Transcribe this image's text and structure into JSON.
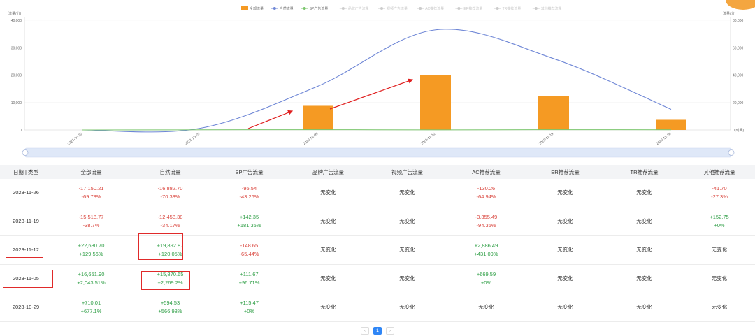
{
  "legend": [
    {
      "label": "全部流量",
      "color": "#f59a23",
      "active": true,
      "kind": "bar"
    },
    {
      "label": "自然流量",
      "color": "#6f87d6",
      "active": true,
      "kind": "line"
    },
    {
      "label": "SP广告流量",
      "color": "#7cc66e",
      "active": true,
      "kind": "line"
    },
    {
      "label": "品牌广告流量",
      "color": "#cccccc",
      "active": false,
      "kind": "line"
    },
    {
      "label": "视频广告流量",
      "color": "#cccccc",
      "active": false,
      "kind": "line"
    },
    {
      "label": "AC推荐流量",
      "color": "#cccccc",
      "active": false,
      "kind": "line"
    },
    {
      "label": "ER推荐流量",
      "color": "#cccccc",
      "active": false,
      "kind": "line"
    },
    {
      "label": "TR推荐流量",
      "color": "#cccccc",
      "active": false,
      "kind": "line"
    },
    {
      "label": "其他推荐流量",
      "color": "#cccccc",
      "active": false,
      "kind": "line"
    }
  ],
  "chart_data": {
    "type": "bar",
    "x": [
      "2023-10-22",
      "2023-10-29",
      "2023-11-05",
      "2023-11-12",
      "2023-11-19",
      "2023-11-26"
    ],
    "left_axis": {
      "label": "流量(分)",
      "ticks": [
        "0",
        "10,000",
        "20,000",
        "30,000",
        "40,000"
      ],
      "ylim": [
        0,
        40000
      ]
    },
    "right_axis": {
      "label": "流量(分)",
      "ticks": [
        "0(时间)",
        "20,000",
        "40,000",
        "60,000",
        "80,000"
      ],
      "ylim": [
        0,
        80000
      ]
    },
    "series": [
      {
        "name": "全部流量",
        "type": "bar",
        "axis": "left",
        "values": [
          0,
          110,
          8800,
          20000,
          12300,
          3700
        ]
      },
      {
        "name": "自然流量",
        "type": "line",
        "axis": "right",
        "values": [
          0,
          1200,
          32000,
          73000,
          52000,
          15000
        ]
      },
      {
        "name": "SP广告流量",
        "type": "line",
        "axis": "right",
        "values": [
          0,
          110,
          220,
          80,
          220,
          130
        ]
      }
    ],
    "annotations": [
      "red-arrow-1",
      "red-arrow-2"
    ]
  },
  "table": {
    "headers": [
      "日期 | 类型",
      "全部流量",
      "自然流量",
      "SP广告流量",
      "品牌广告流量",
      "视频广告流量",
      "AC推荐流量",
      "ER推荐流量",
      "TR推荐流量",
      "其他推荐流量"
    ],
    "rows": [
      {
        "date": "2023-11-26",
        "cells": [
          {
            "v": "-17,150.21",
            "p": "-69.78%",
            "c": "red"
          },
          {
            "v": "-16,882.70",
            "p": "-70.33%",
            "c": "red"
          },
          {
            "v": "-95.54",
            "p": "-43.26%",
            "c": "red"
          },
          {
            "v": "无变化",
            "c": "flat"
          },
          {
            "v": "无变化",
            "c": "flat"
          },
          {
            "v": "-130.26",
            "p": "-64.94%",
            "c": "red"
          },
          {
            "v": "无变化",
            "c": "flat"
          },
          {
            "v": "无变化",
            "c": "flat"
          },
          {
            "v": "-41.70",
            "p": "-27.3%",
            "c": "red"
          }
        ]
      },
      {
        "date": "2023-11-19",
        "cells": [
          {
            "v": "-15,518.77",
            "p": "-38.7%",
            "c": "red"
          },
          {
            "v": "-12,458.38",
            "p": "-34.17%",
            "c": "red"
          },
          {
            "v": "+142.35",
            "p": "+181.35%",
            "c": "green"
          },
          {
            "v": "无变化",
            "c": "flat"
          },
          {
            "v": "无变化",
            "c": "flat"
          },
          {
            "v": "-3,355.49",
            "p": "-94.36%",
            "c": "red"
          },
          {
            "v": "无变化",
            "c": "flat"
          },
          {
            "v": "无变化",
            "c": "flat"
          },
          {
            "v": "+152.75",
            "p": "+0%",
            "c": "green"
          }
        ]
      },
      {
        "date": "2023-11-12",
        "cells": [
          {
            "v": "+22,630.70",
            "p": "+129.56%",
            "c": "green"
          },
          {
            "v": "+19,892.87",
            "p": "+120.05%",
            "c": "green"
          },
          {
            "v": "-148.65",
            "p": "-65.44%",
            "c": "red"
          },
          {
            "v": "无变化",
            "c": "flat"
          },
          {
            "v": "无变化",
            "c": "flat"
          },
          {
            "v": "+2,886.49",
            "p": "+431.09%",
            "c": "green"
          },
          {
            "v": "无变化",
            "c": "flat"
          },
          {
            "v": "无变化",
            "c": "flat"
          },
          {
            "v": "无变化",
            "c": "flat"
          }
        ]
      },
      {
        "date": "2023-11-05",
        "cells": [
          {
            "v": "+16,651.90",
            "p": "+2,043.51%",
            "c": "green"
          },
          {
            "v": "+15,870.65",
            "p": "+2,269.2%",
            "c": "green"
          },
          {
            "v": "+111.67",
            "p": "+96.71%",
            "c": "green"
          },
          {
            "v": "无变化",
            "c": "flat"
          },
          {
            "v": "无变化",
            "c": "flat"
          },
          {
            "v": "+669.59",
            "p": "+0%",
            "c": "green"
          },
          {
            "v": "无变化",
            "c": "flat"
          },
          {
            "v": "无变化",
            "c": "flat"
          },
          {
            "v": "无变化",
            "c": "flat"
          }
        ]
      },
      {
        "date": "2023-10-29",
        "cells": [
          {
            "v": "+710.01",
            "p": "+677.1%",
            "c": "green"
          },
          {
            "v": "+594.53",
            "p": "+566.98%",
            "c": "green"
          },
          {
            "v": "+115.47",
            "p": "+0%",
            "c": "green"
          },
          {
            "v": "无变化",
            "c": "flat"
          },
          {
            "v": "无变化",
            "c": "flat"
          },
          {
            "v": "无变化",
            "c": "flat"
          },
          {
            "v": "无变化",
            "c": "flat"
          },
          {
            "v": "无变化",
            "c": "flat"
          },
          {
            "v": "无变化",
            "c": "flat"
          }
        ]
      }
    ]
  },
  "pagination": {
    "prev": "‹",
    "current": "1",
    "next": "›"
  }
}
